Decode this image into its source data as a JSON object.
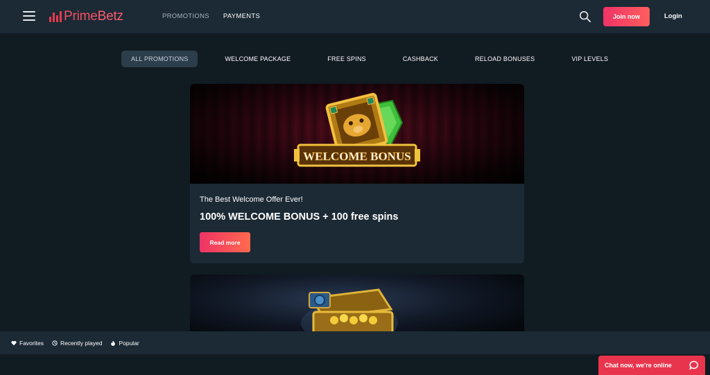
{
  "brand": {
    "name_prime": "Prime",
    "name_betz": "Betz",
    "accent": "#f24f62"
  },
  "nav": {
    "promotions": "PROMOTIONS",
    "payments": "PAYMENTS",
    "join_label": "Join now",
    "login_label": "Login"
  },
  "tabs": [
    {
      "label": "ALL PROMOTIONS"
    },
    {
      "label": "WELCOME PACKAGE"
    },
    {
      "label": "FREE SPINS"
    },
    {
      "label": "CASHBACK"
    },
    {
      "label": "RELOAD BONUSES"
    },
    {
      "label": "VIP LEVELS"
    }
  ],
  "promo1": {
    "banner_text": "WELCOME BONUS",
    "subtitle": "The Best Welcome Offer Ever!",
    "title": "100% WELCOME BONUS + 100 free spins",
    "button": "Read more"
  },
  "bottom_bar": {
    "favorites": "Favorites",
    "recently_played": "Recently played",
    "popular": "Popular"
  },
  "chat": {
    "label": "Chat now, we're online"
  },
  "icons": [
    "menu-icon",
    "search-icon",
    "heart-icon",
    "clock-icon",
    "flame-icon",
    "chat-icon"
  ]
}
